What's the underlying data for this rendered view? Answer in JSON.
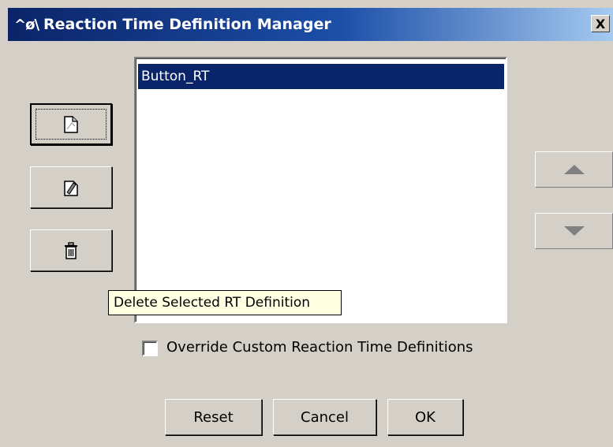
{
  "window": {
    "title": "Reaction Time Definition Manager",
    "icon_text": "^ø\\",
    "close_label": "X"
  },
  "toolbar": {
    "new_icon": "new-document-icon",
    "edit_icon": "edit-document-icon",
    "delete_icon": "trash-icon"
  },
  "list": {
    "items": [
      "Button_RT"
    ],
    "selected_index": 0
  },
  "tooltip": "Delete Selected RT Definition",
  "override_checkbox": {
    "label": "Override Custom Reaction Time Definitions",
    "checked": false
  },
  "buttons": {
    "reset": "Reset",
    "cancel": "Cancel",
    "ok": "OK"
  },
  "colors": {
    "title_gradient_start": "#0b2468",
    "title_gradient_end": "#a6caf0",
    "selection": "#0a246a",
    "dialog_bg": "#d4d0c8",
    "tooltip_bg": "#ffffe1"
  }
}
